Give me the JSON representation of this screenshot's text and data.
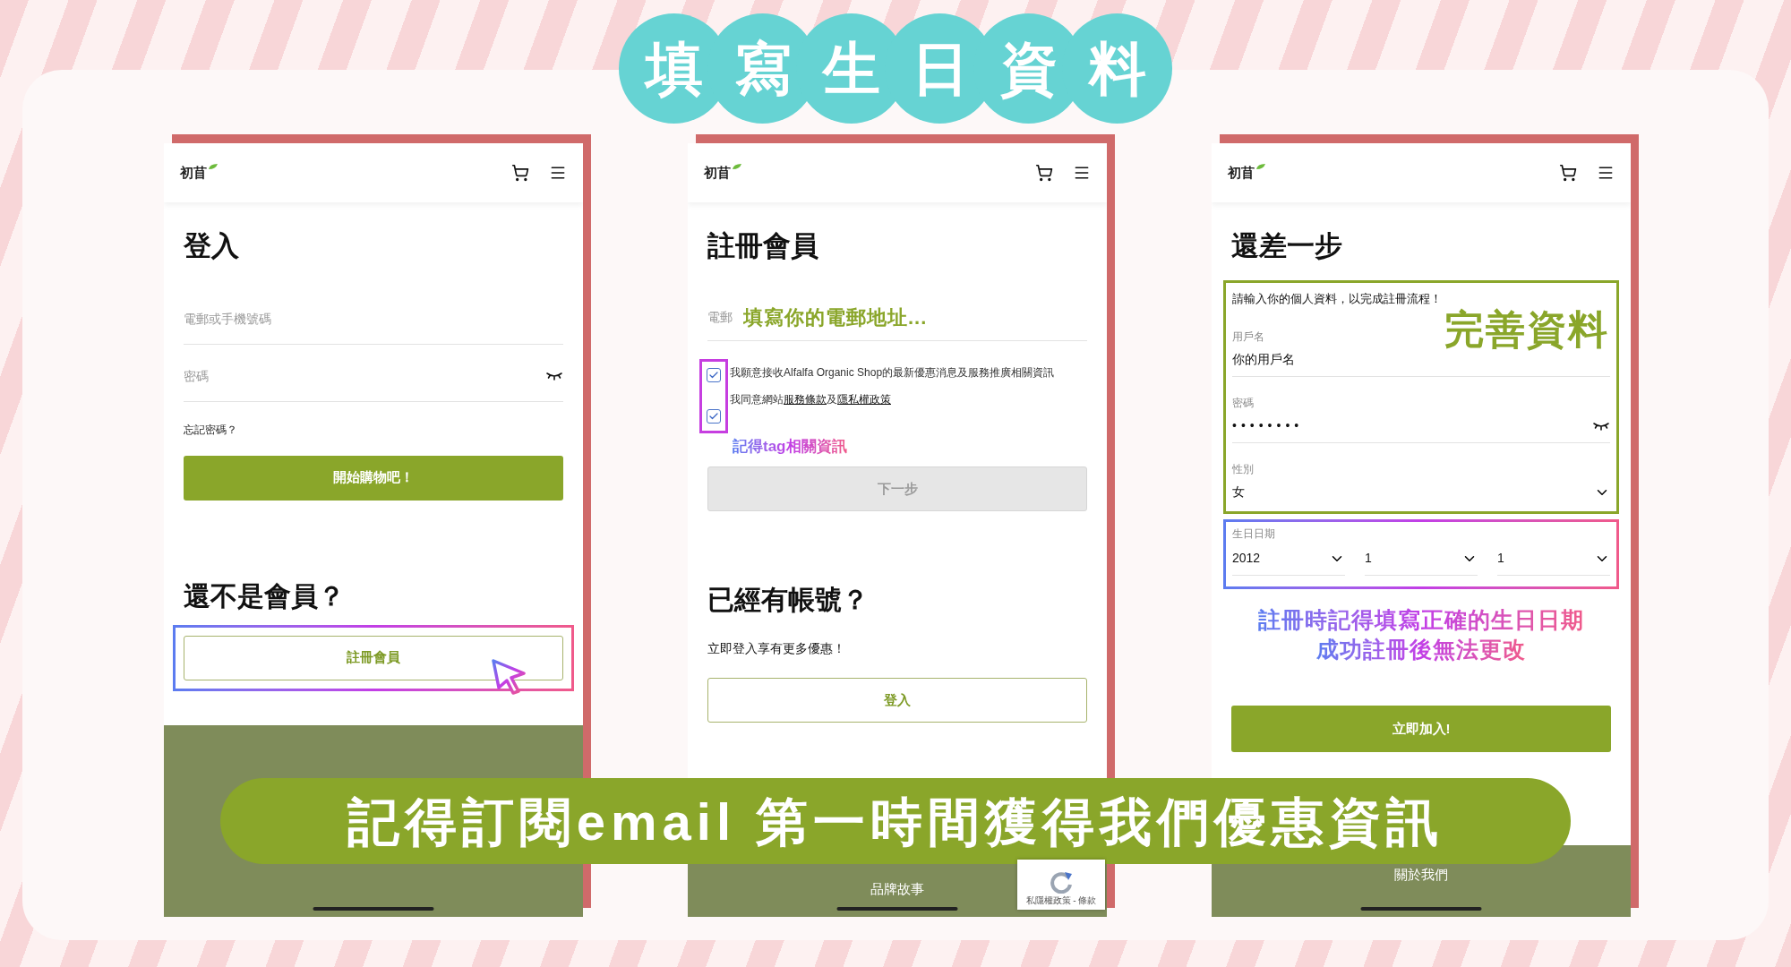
{
  "title": {
    "characters": [
      "填",
      "寫",
      "生",
      "日",
      "資",
      "料"
    ]
  },
  "login_screen": {
    "logo": "初苜",
    "heading": "登入",
    "fields": [
      {
        "kind": "text",
        "placeholder": "電郵或手機號碼"
      },
      {
        "kind": "password",
        "placeholder": "密碼"
      }
    ],
    "forgot_link": "忘記密碼？",
    "primary_button": "開始購物吧！",
    "section_heading": "還不是會員？",
    "register_button": "註冊會員",
    "register_highlighted": true
  },
  "register_screen": {
    "logo": "初苜",
    "heading": "註冊會員",
    "email_label": "電郵",
    "email_placeholder": "填寫你的電郵地址...",
    "consents": [
      {
        "kind": "plain",
        "text": "我願意接收Alfalfa Organic Shop的最新優惠消息及服務推廣相關資訊",
        "checked": true
      },
      {
        "kind": "links",
        "prefix": "我同意網站",
        "links": [
          "服務條款",
          "隱私權政策"
        ],
        "joiner": "及",
        "checked": true
      }
    ],
    "note": "記得tag相關資訊",
    "next_button": {
      "label": "下一步",
      "disabled": true
    },
    "section_heading": "已經有帳號？",
    "section_text": "立即登入享有更多優惠！",
    "login_button": "登入",
    "footer_links": [
      "品牌故事"
    ],
    "captcha_text": "私隱權政策 - 條款"
  },
  "profile_screen": {
    "logo": "初苜",
    "heading": "還差一步",
    "intro": "請輸入你的個人資料，以完成註冊流程！",
    "note": "完善資料",
    "fields": [
      {
        "kind": "text",
        "label": "用戶名",
        "value": "你的用戶名"
      },
      {
        "kind": "password",
        "label": "密碼",
        "value": "••••••••"
      },
      {
        "kind": "select",
        "label": "性別",
        "value": "女"
      }
    ],
    "birthday": {
      "label": "生日日期",
      "selects": [
        "2012",
        "1",
        "1"
      ]
    },
    "warning": [
      "註冊時記得填寫正確的生日日期",
      "成功註冊後無法更改"
    ],
    "join_button": "立即加入!",
    "footer_links": [
      "關於我們"
    ]
  },
  "banner": "記得訂閱email 第一時間獲得我們優惠資訊"
}
